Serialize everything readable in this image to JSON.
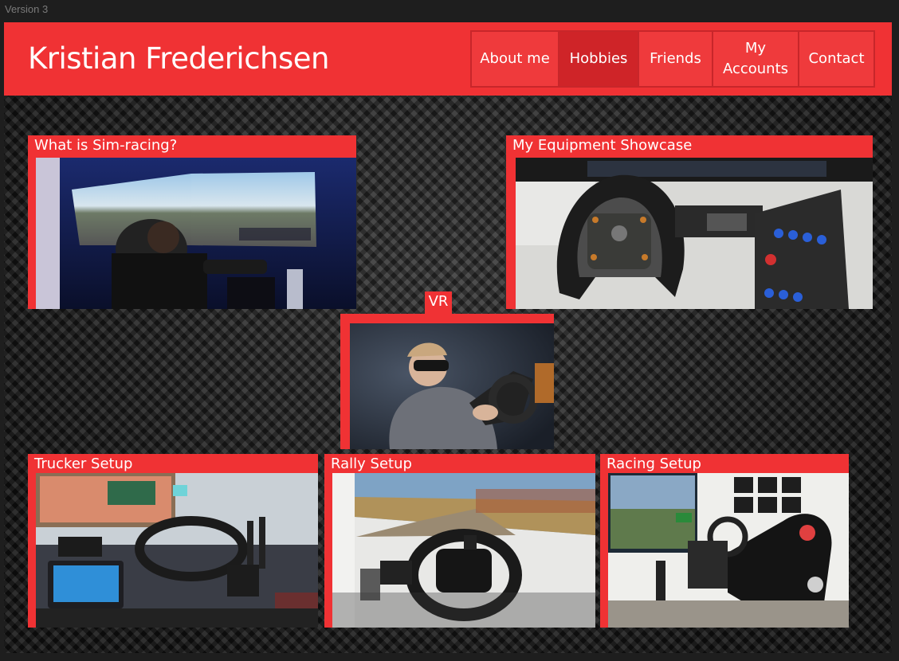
{
  "version_label": "Version 3",
  "site_title": "Kristian Frederichsen",
  "nav": [
    {
      "label": "About me",
      "active": false
    },
    {
      "label": "Hobbies",
      "active": true
    },
    {
      "label": "Friends",
      "active": false
    },
    {
      "label": "My\nAccounts",
      "active": false
    },
    {
      "label": "Contact",
      "active": false
    }
  ],
  "cards": {
    "sim_racing": {
      "title": "What is Sim-racing?"
    },
    "equipment": {
      "title": "My Equipment Showcase"
    },
    "vr": {
      "title": "VR"
    },
    "trucker": {
      "title": "Trucker Setup"
    },
    "rally": {
      "title": "Rally Setup"
    },
    "racing": {
      "title": "Racing Setup"
    }
  },
  "colors": {
    "accent": "#f03234",
    "accent_dark": "#cf2428",
    "background": "#1e1e1e"
  }
}
